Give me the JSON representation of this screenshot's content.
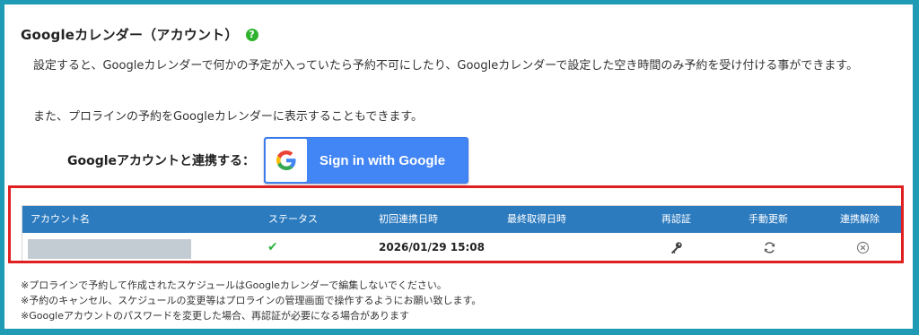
{
  "section": {
    "title": "Googleカレンダー（アカウント）",
    "help_icon": "?",
    "description_1": "設定すると、Googleカレンダーで何かの予定が入っていたら予約不可にしたり、Googleカレンダーで設定した空き時間のみ予約を受け付ける事ができます。",
    "description_2": "また、プロラインの予約をGoogleカレンダーに表示することもできます。"
  },
  "link": {
    "label": "Googleアカウントと連携する：",
    "button_text": "Sign in with Google"
  },
  "table": {
    "headers": {
      "account": "アカウント名",
      "status": "ステータス",
      "first_linked": "初回連携日時",
      "last_fetched": "最終取得日時",
      "reauth": "再認証",
      "manual_update": "手動更新",
      "unlink": "連携解除"
    },
    "rows": [
      {
        "account": "",
        "status_icon": "check-icon",
        "first_linked": "2026/01/29 15:08",
        "last_fetched": "",
        "reauth_icon": "key-icon",
        "manual_update_icon": "refresh-icon",
        "unlink_icon": "close-circle-icon"
      }
    ]
  },
  "notes": [
    "※プロラインで予約して作成されたスケジュールはGoogleカレンダーで編集しないでください。",
    "※予約のキャンセル、スケジュールの変更等はプロラインの管理画面で操作するようにお願い致します。",
    "※Googleアカウントのパスワードを変更した場合、再認証が必要になる場合があります"
  ],
  "colors": {
    "frame": "#1f9bb5",
    "table_header": "#2c7bbf",
    "highlight_border": "#e02020",
    "google_blue": "#4285f4",
    "check_green": "#2fb344"
  }
}
